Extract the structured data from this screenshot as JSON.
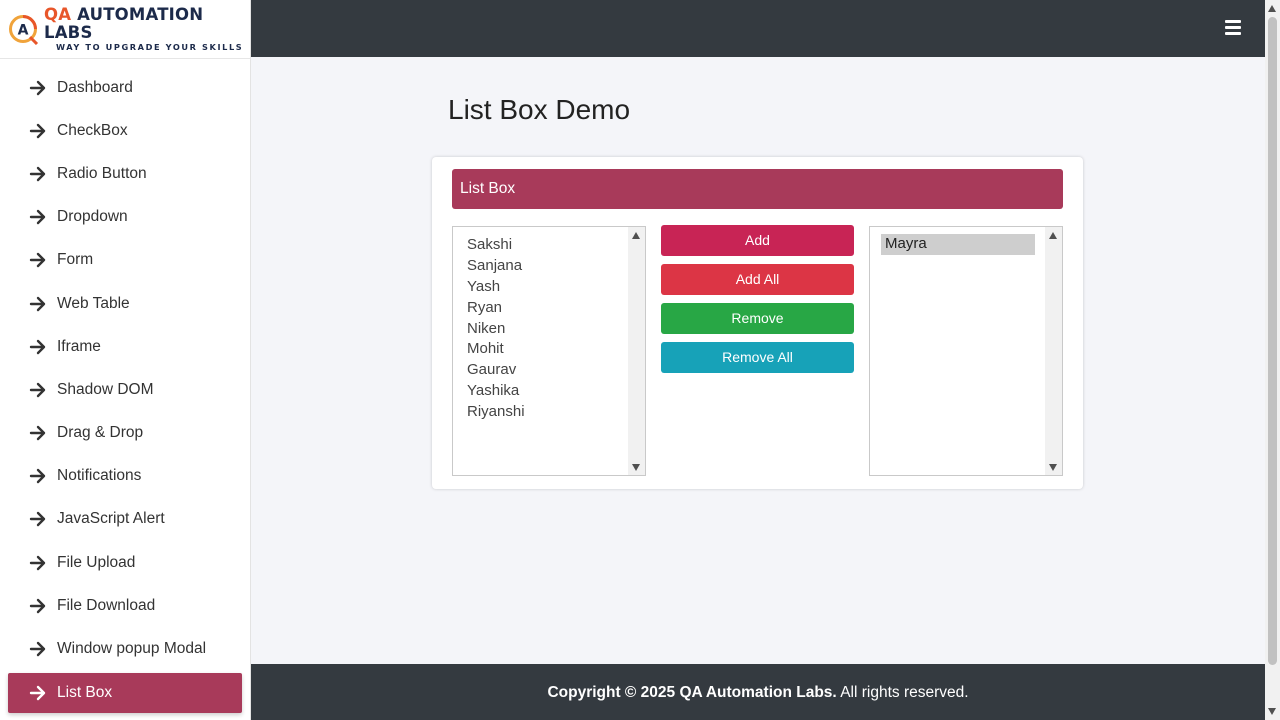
{
  "logo": {
    "title_prefix": "QA",
    "title_rest": " AUTOMATION LABS",
    "tagline": "WAY TO UPGRADE YOUR SKILLS",
    "icon": "qa-logo-icon"
  },
  "sidebar": {
    "items": [
      {
        "label": "Dashboard"
      },
      {
        "label": "CheckBox"
      },
      {
        "label": "Radio Button"
      },
      {
        "label": "Dropdown"
      },
      {
        "label": "Form"
      },
      {
        "label": "Web Table"
      },
      {
        "label": "Iframe"
      },
      {
        "label": "Shadow DOM"
      },
      {
        "label": "Drag & Drop"
      },
      {
        "label": "Notifications"
      },
      {
        "label": "JavaScript Alert"
      },
      {
        "label": "File Upload"
      },
      {
        "label": "File Download"
      },
      {
        "label": "Window popup Modal"
      },
      {
        "label": "List Box",
        "active": true
      }
    ],
    "item_icon": "arrow-right-icon"
  },
  "header": {
    "menu_icon": "hamburger-icon"
  },
  "main": {
    "title": "List Box Demo",
    "card_title": "List Box",
    "left_list": [
      "Sakshi",
      "Sanjana",
      "Yash",
      "Ryan",
      "Niken",
      "Mohit",
      "Gaurav",
      "Yashika",
      "Riyanshi"
    ],
    "right_list": [
      "Mayra"
    ],
    "right_selected": "Mayra",
    "buttons": {
      "add": "Add",
      "add_all": "Add All",
      "remove": "Remove",
      "remove_all": "Remove All"
    }
  },
  "footer": {
    "copyright_bold": "Copyright © 2025 QA Automation Labs.",
    "copyright_rest": " All rights reserved."
  },
  "colors": {
    "accent": "#a83a5a",
    "topbar": "#343a40",
    "add": "#c82455",
    "add_all": "#dc3545",
    "remove": "#28a745",
    "remove_all": "#17a2b8"
  }
}
